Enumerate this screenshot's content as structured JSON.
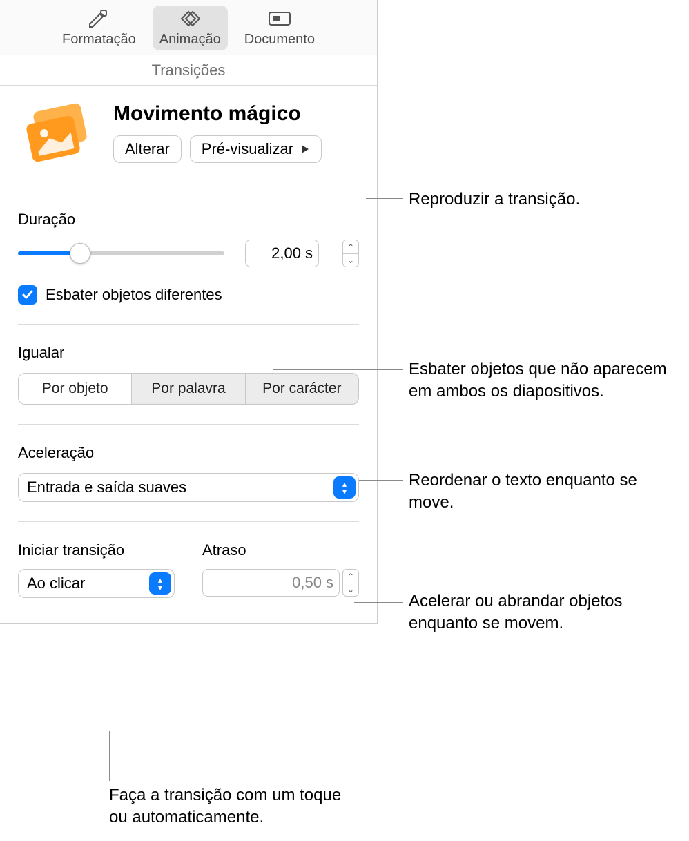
{
  "toolbar": {
    "format": "Formatação",
    "animate": "Animação",
    "document": "Documento"
  },
  "sectionTab": "Transições",
  "header": {
    "title": "Movimento mágico",
    "changeBtn": "Alterar",
    "previewBtn": "Pré-visualizar"
  },
  "duration": {
    "label": "Duração",
    "value": "2,00",
    "unit": "s"
  },
  "fadeCheck": {
    "label": "Esbater objetos diferentes",
    "checked": true
  },
  "match": {
    "label": "Igualar",
    "options": [
      "Por objeto",
      "Por palavra",
      "Por carácter"
    ],
    "selectedIndex": 0
  },
  "acceleration": {
    "label": "Aceleração",
    "value": "Entrada e saída suaves"
  },
  "start": {
    "label": "Iniciar transição",
    "value": "Ao clicar"
  },
  "delay": {
    "label": "Atraso",
    "value": "0,50",
    "unit": "s"
  },
  "callouts": {
    "preview": "Reproduzir a transição.",
    "fade": "Esbater objetos que não aparecem em ambos os diapositivos.",
    "match": "Reordenar o texto enquanto se move.",
    "accel": "Acelerar ou abrandar objetos enquanto se movem.",
    "start": "Faça a transição com um toque ou automaticamente."
  }
}
